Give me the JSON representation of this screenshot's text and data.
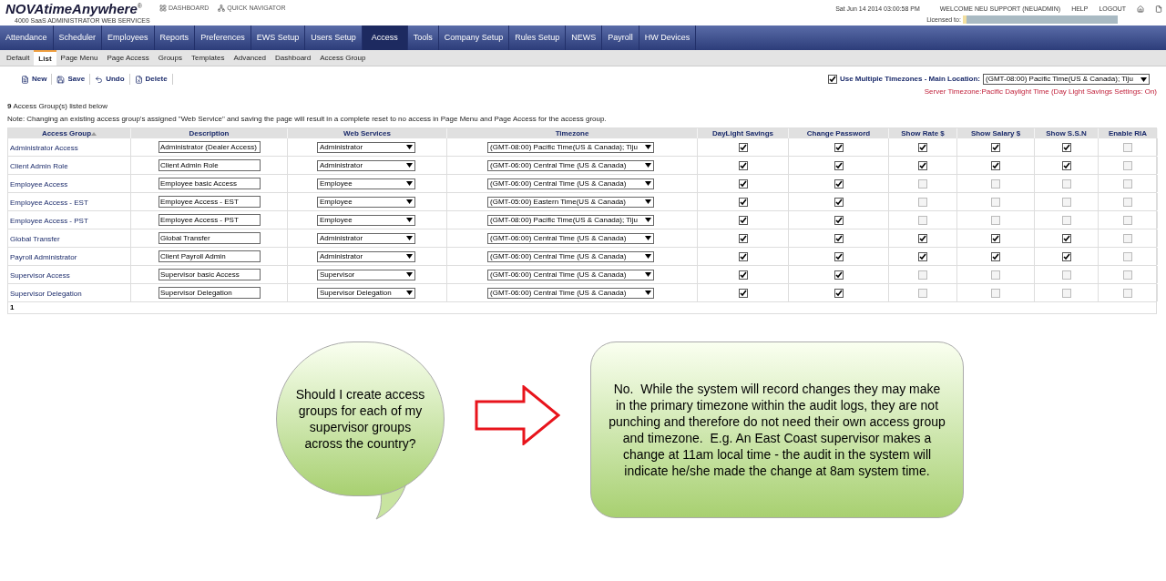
{
  "header": {
    "logo": "NOVAtimeAnywhere",
    "logo_mark": "®",
    "logo_sub": "4000 SaaS  ADMINISTRATOR WEB SERVICES",
    "links": [
      "DASHBOARD",
      "QUICK NAVIGATOR"
    ],
    "datetime": "Sat Jun 14 2014 03:00:58 PM",
    "welcome": "WELCOME NEU SUPPORT (NEUADMIN)",
    "help": "HELP",
    "logout": "LOGOUT",
    "licensed_label": "Licensed to:"
  },
  "nav": [
    {
      "label": "Attendance",
      "selected": false
    },
    {
      "label": "Scheduler",
      "selected": false
    },
    {
      "label": "Employees",
      "selected": false
    },
    {
      "label": "Reports",
      "selected": false
    },
    {
      "label": "Preferences",
      "selected": false
    },
    {
      "label": "EWS Setup",
      "selected": false
    },
    {
      "label": "Users Setup",
      "selected": false
    },
    {
      "label": "Access",
      "selected": true
    },
    {
      "label": "Tools",
      "selected": false
    },
    {
      "label": "Company Setup",
      "selected": false
    },
    {
      "label": "Rules Setup",
      "selected": false
    },
    {
      "label": "NEWS",
      "selected": false
    },
    {
      "label": "Payroll",
      "selected": false
    },
    {
      "label": "HW Devices",
      "selected": false
    }
  ],
  "subtabs": [
    {
      "label": "Default",
      "selected": false
    },
    {
      "label": "List",
      "selected": true
    },
    {
      "label": "Page Menu",
      "selected": false
    },
    {
      "label": "Page Access",
      "selected": false
    },
    {
      "label": "Groups",
      "selected": false
    },
    {
      "label": "Templates",
      "selected": false
    },
    {
      "label": "Advanced",
      "selected": false
    },
    {
      "label": "Dashboard",
      "selected": false
    },
    {
      "label": "Access Group",
      "selected": false
    }
  ],
  "toolbar": [
    {
      "label": "New",
      "kind": "new"
    },
    {
      "label": "Save",
      "kind": "save"
    },
    {
      "label": "Undo",
      "kind": "undo"
    },
    {
      "label": "Delete",
      "kind": "delete"
    }
  ],
  "timezone_option": {
    "label": "Use Multiple Timezones - Main Location:",
    "checked": true,
    "value": "(GMT-08:00) Pacific Time(US & Canada); Tiju"
  },
  "server_timezone": "Server Timezone:Pacific Daylight Time (Day Light Savings Settings: On)",
  "count": "9",
  "count_text": "Access Group(s) listed below",
  "note": "Note: Changing an existing access group's assigned \"Web Service\" and saving the page will result in a complete reset to no access in Page Menu and Page Access for the access group.",
  "table": {
    "columns": [
      "Access Group",
      "Description",
      "Web Services",
      "Timezone",
      "DayLight Savings",
      "Change Password",
      "Show Rate $",
      "Show Salary $",
      "Show S.S.N",
      "Enable RIA"
    ],
    "rows": [
      {
        "name": "Administrator Access",
        "description": "Administrator (Dealer Access)",
        "web_service": "Administrator",
        "timezone": "(GMT-08:00) Pacific Time(US & Canada); Tiju",
        "checks": [
          true,
          true,
          true,
          true,
          true,
          false
        ]
      },
      {
        "name": "Client Admin Role",
        "description": "Client Admin Role",
        "web_service": "Administrator",
        "timezone": "(GMT-06:00) Central Time (US & Canada)",
        "checks": [
          true,
          true,
          true,
          true,
          true,
          false
        ]
      },
      {
        "name": "Employee Access",
        "description": "Employee basic Access",
        "web_service": "Employee",
        "timezone": "(GMT-06:00) Central Time (US & Canada)",
        "checks": [
          true,
          true,
          false,
          false,
          false,
          false
        ]
      },
      {
        "name": "Employee Access - EST",
        "description": "Employee Access - EST",
        "web_service": "Employee",
        "timezone": "(GMT-05:00) Eastern Time(US & Canada)",
        "checks": [
          true,
          true,
          false,
          false,
          false,
          false
        ]
      },
      {
        "name": "Employee Access - PST",
        "description": "Employee Access - PST",
        "web_service": "Employee",
        "timezone": "(GMT-08:00) Pacific Time(US & Canada); Tiju",
        "checks": [
          true,
          true,
          false,
          false,
          false,
          false
        ]
      },
      {
        "name": "Global Transfer",
        "description": "Global Transfer",
        "web_service": "Administrator",
        "timezone": "(GMT-06:00) Central Time (US & Canada)",
        "checks": [
          true,
          true,
          true,
          true,
          true,
          false
        ]
      },
      {
        "name": "Payroll Administrator",
        "description": "Client Payroll Admin",
        "web_service": "Administrator",
        "timezone": "(GMT-06:00) Central Time (US & Canada)",
        "checks": [
          true,
          true,
          true,
          true,
          true,
          false
        ]
      },
      {
        "name": "Supervisor Access",
        "description": "Supervisor basic Access",
        "web_service": "Supervisor",
        "timezone": "(GMT-06:00) Central Time (US & Canada)",
        "checks": [
          true,
          true,
          false,
          false,
          false,
          false
        ]
      },
      {
        "name": "Supervisor Delegation",
        "description": "Supervisor Delegation",
        "web_service": "Supervisor Delegation",
        "timezone": "(GMT-06:00) Central Time (US & Canada)",
        "checks": [
          true,
          true,
          false,
          false,
          false,
          false
        ]
      }
    ],
    "page": "1"
  },
  "question": "Should I create access groups for each of my supervisor groups across the country?",
  "answer": "No.  While the system will record changes they may make in the primary timezone within the audit logs, they are not punching and therefore do not need their own access group and timezone.  E.g. An East Coast supervisor makes a change at 11am local time - the audit in the system will indicate he/she made the change at 8am system time."
}
